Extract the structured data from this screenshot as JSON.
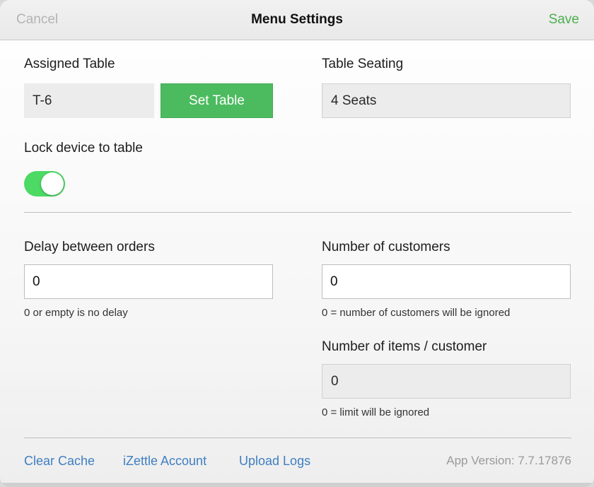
{
  "nav": {
    "cancel_label": "Cancel",
    "title": "Menu Settings",
    "save_label": "Save"
  },
  "assigned_table": {
    "label": "Assigned Table",
    "value": "T-6",
    "set_button_label": "Set Table"
  },
  "table_seating": {
    "label": "Table Seating",
    "value": "4 Seats"
  },
  "lock_device": {
    "label": "Lock device to table",
    "enabled": true
  },
  "delay_between_orders": {
    "label": "Delay between orders",
    "value": "0",
    "hint": "0 or empty is no delay"
  },
  "number_of_customers": {
    "label": "Number of customers",
    "value": "0",
    "hint": "0 = number of customers will be ignored"
  },
  "items_per_customer": {
    "label": "Number of items / customer",
    "value": "0",
    "hint": "0 = limit will be ignored"
  },
  "footer": {
    "clear_cache_label": "Clear Cache",
    "izettle_label": "iZettle Account",
    "upload_logs_label": "Upload Logs",
    "app_version": "App Version: 7.7.17876"
  },
  "colors": {
    "accent_green": "#4cbb5f",
    "toggle_on": "#4cd964",
    "link_blue": "#3f7fc1"
  }
}
